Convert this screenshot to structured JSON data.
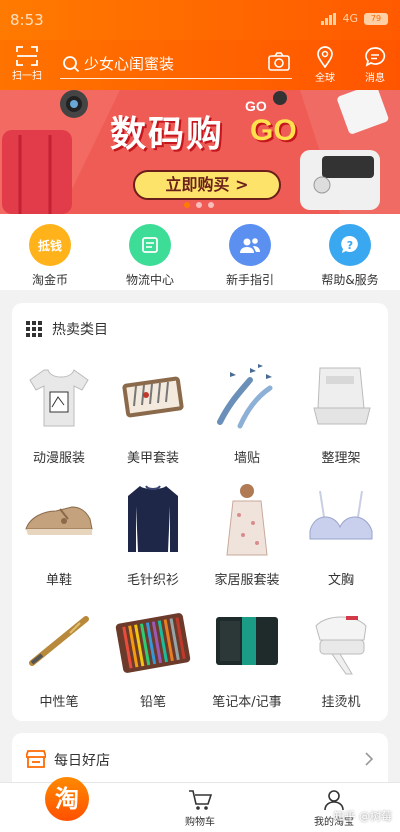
{
  "status_bar": {
    "time": "8:53",
    "network": "4G",
    "battery": "79"
  },
  "header": {
    "scan_label": "扫一扫",
    "search_placeholder": "少女心闺蜜装",
    "globe_label": "全球",
    "message_label": "消息"
  },
  "banner": {
    "title": "数码购",
    "go_small": "GO",
    "go_big": "GO",
    "button_label": "立即购买 >",
    "slides": 3,
    "active_slide": 0
  },
  "quick_nav": {
    "items": [
      {
        "label": "淘金币",
        "icon": "coin-icon",
        "color": "#ffb21a",
        "badge": "抵钱"
      },
      {
        "label": "物流中心",
        "icon": "logistics-icon",
        "color": "#3ddc97"
      },
      {
        "label": "新手指引",
        "icon": "guide-icon",
        "color": "#5b8ff0"
      },
      {
        "label": "帮助&服务",
        "icon": "help-icon",
        "color": "#3aa8f0"
      }
    ]
  },
  "hot_categories": {
    "title": "热卖类目",
    "items": [
      {
        "label": "动漫服装",
        "icon": "tshirt-icon"
      },
      {
        "label": "美甲套装",
        "icon": "manicure-kit-icon"
      },
      {
        "label": "墙贴",
        "icon": "wall-sticker-icon"
      },
      {
        "label": "整理架",
        "icon": "storage-rack-icon"
      },
      {
        "label": "单鞋",
        "icon": "shoe-icon"
      },
      {
        "label": "毛针织衫",
        "icon": "sweater-icon"
      },
      {
        "label": "家居服套装",
        "icon": "homewear-icon"
      },
      {
        "label": "文胸",
        "icon": "bra-icon"
      },
      {
        "label": "中性笔",
        "icon": "pen-icon"
      },
      {
        "label": "铅笔",
        "icon": "pencil-case-icon"
      },
      {
        "label": "笔记本/记事",
        "icon": "notebook-icon"
      },
      {
        "label": "挂烫机",
        "icon": "steamer-icon"
      }
    ]
  },
  "daily_shop": {
    "title": "每日好店"
  },
  "tab_bar": {
    "home_label": "淘",
    "cart_label": "购物车",
    "profile_label": "我的淘宝"
  },
  "watermark": "知乎 @树莓",
  "colors": {
    "brand": "#ff6a00",
    "banner_bg": "#ee5c55"
  }
}
